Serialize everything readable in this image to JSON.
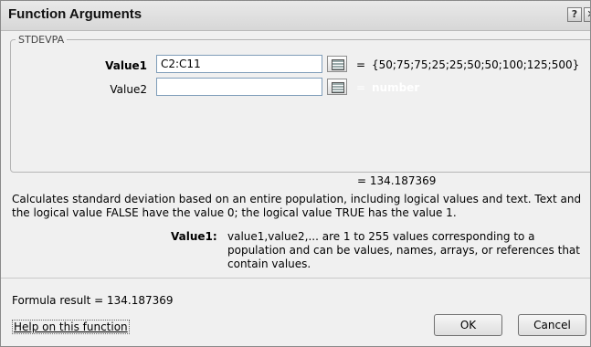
{
  "window": {
    "title": "Function Arguments",
    "help_glyph": "?",
    "close_glyph": "✕"
  },
  "function_group": {
    "label": "STDEVPA"
  },
  "arguments": [
    {
      "label": "Value1",
      "value": "C2:C11",
      "eq": "=",
      "evaluated": "{50;75;75;25;25;50;50;100;125;500}"
    },
    {
      "label": "Value2",
      "value": "",
      "eq": "=",
      "evaluated": "number",
      "evaluated_color": "#ffffff"
    }
  ],
  "result_line": "=  134.187369",
  "description": "Calculates standard deviation based on an entire population, including logical values and text. Text and the logical value FALSE have the value 0; the logical value TRUE has the value 1.",
  "arg_help": {
    "label": "Value1:",
    "text": "value1,value2,... are 1 to 255 values corresponding to a population and can be values, names, arrays, or references that contain values."
  },
  "formula_result": "Formula result =   134.187369",
  "help_link": "Help on this function",
  "buttons": {
    "ok": "OK",
    "cancel": "Cancel"
  },
  "colors": {
    "input_border": "#7f9db9",
    "dialog_bg": "#f0f0f0"
  },
  "icons": [
    "collapse-dialog-icon",
    "help-icon",
    "close-icon"
  ]
}
